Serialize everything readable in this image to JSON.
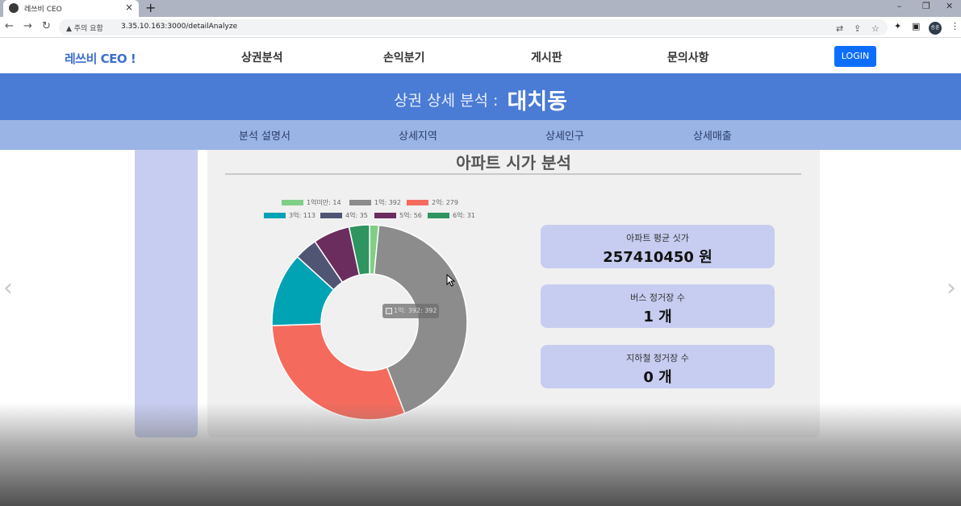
{
  "browser": {
    "tab_title": "레쓰비 CEO",
    "tab_close": "×",
    "new_tab": "+",
    "url_warning": "▲ 주의 요함",
    "url": "3.35.10.163:3000/detailAnalyze",
    "profile_label": "승훈",
    "window_controls": [
      "–",
      "❐",
      "✕"
    ]
  },
  "site": {
    "logo": "레쓰비 CEO !",
    "nav": [
      "상권분석",
      "손익분기",
      "게시판",
      "문의사항"
    ],
    "login": "LOGIN",
    "title_prefix": "상권 상세 분석 :",
    "title_area": "대치동",
    "subnav": [
      "분석 설명서",
      "상세지역",
      "상세인구",
      "상세매출"
    ]
  },
  "card": {
    "title": "아파트 시가 분석"
  },
  "stats": [
    {
      "label": "아파트 평균 싯가",
      "value": "257410450 원"
    },
    {
      "label": "버스 정거장 수",
      "value": "1 개"
    },
    {
      "label": "지하철 정거장 수",
      "value": "0 개"
    }
  ],
  "tooltip": "1억: 392: 392",
  "carousel": {
    "prev": "‹",
    "next": "›"
  },
  "chart_data": {
    "type": "pie",
    "variant": "doughnut",
    "categories": [
      "1억미만",
      "1억",
      "2억",
      "3억",
      "4억",
      "5억",
      "6억"
    ],
    "values": [
      14,
      392,
      279,
      113,
      35,
      56,
      31
    ],
    "legend_labels": [
      "1억미만: 14",
      "1억: 392",
      "2억: 279",
      "3억: 113",
      "4억: 35",
      "5억: 56",
      "6억: 31"
    ],
    "colors": [
      "#7fcf86",
      "#8c8c8c",
      "#f46b5d",
      "#00a3b4",
      "#4f5573",
      "#6b2d5e",
      "#2e9460"
    ],
    "legend_position": "top"
  }
}
